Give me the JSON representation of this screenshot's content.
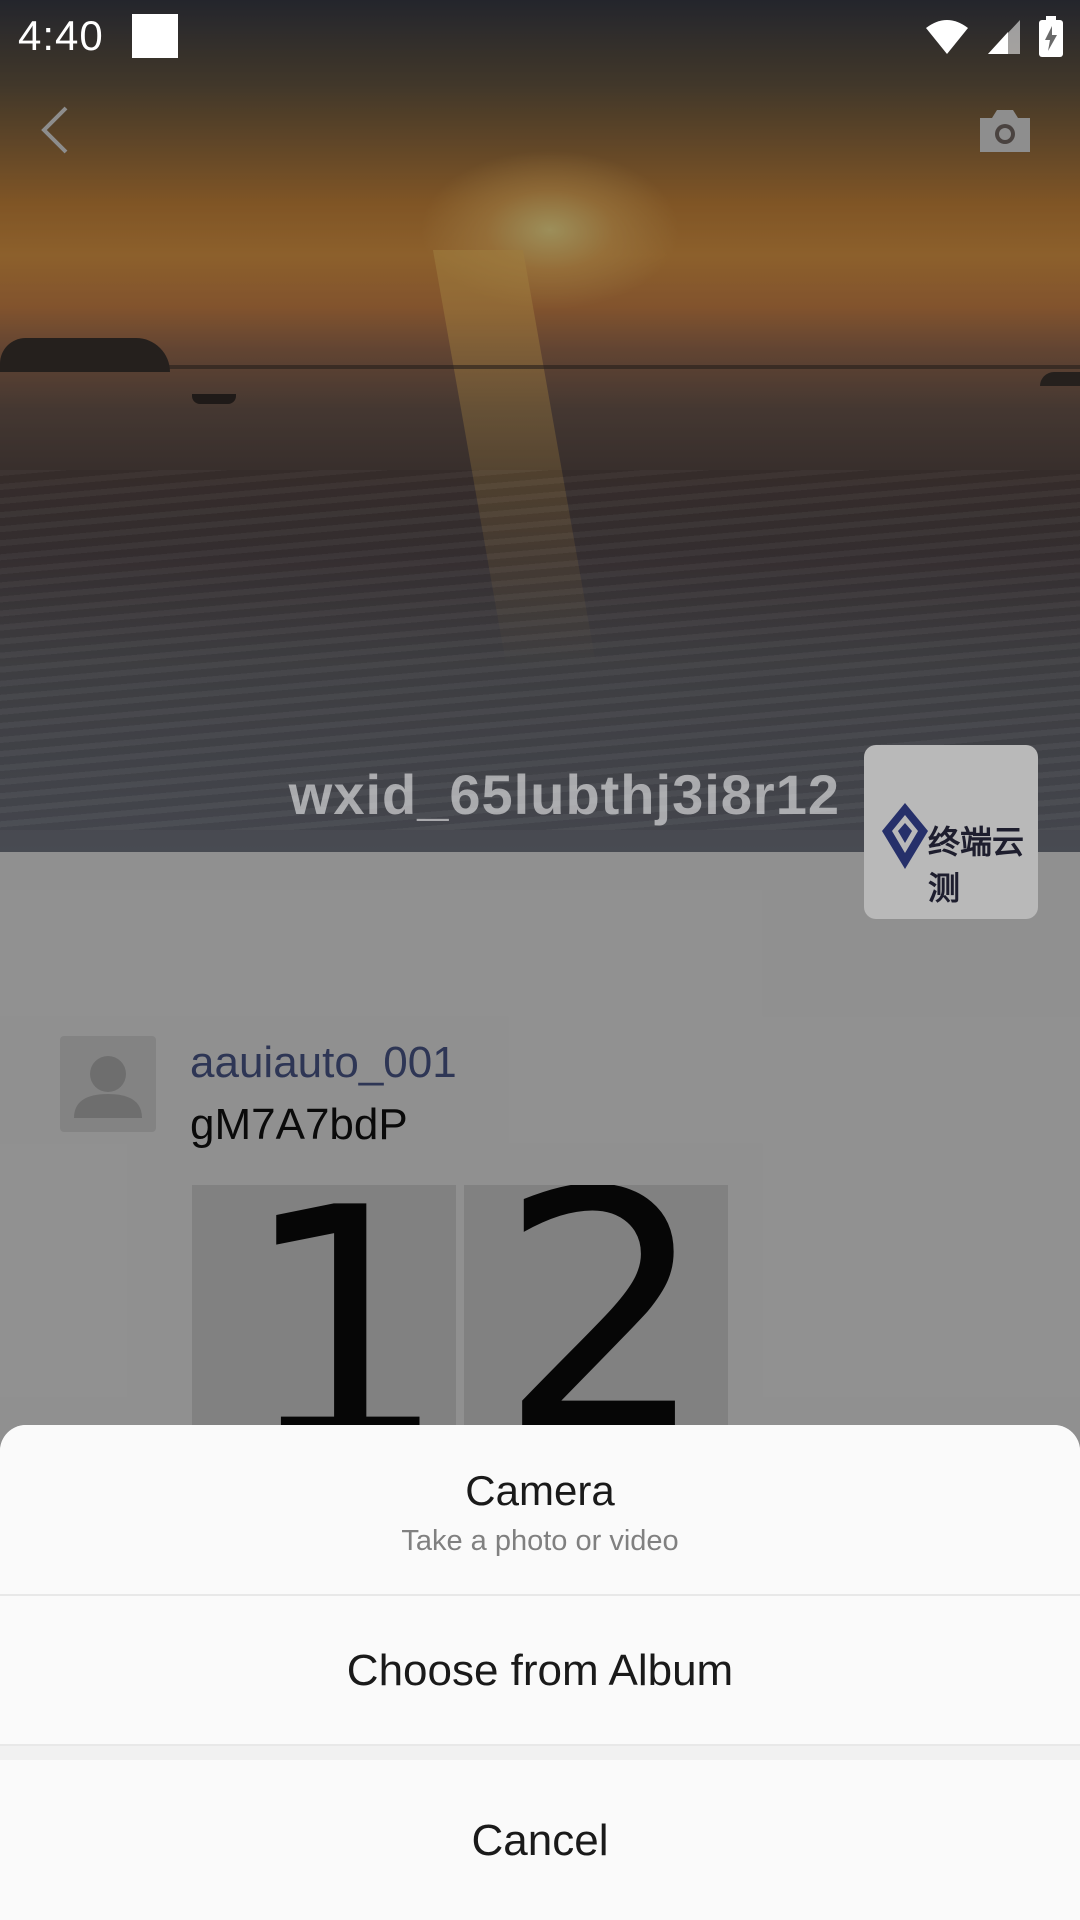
{
  "status_bar": {
    "time": "4:40"
  },
  "cover": {
    "username": "wxid_65lubthj3i8r12",
    "avatar_logo_text": "终端云测"
  },
  "post": {
    "author": "aauiauto_001",
    "text": "gM7A7bdP",
    "images": [
      "1",
      "2"
    ]
  },
  "action_sheet": {
    "camera_title": "Camera",
    "camera_subtitle": "Take a photo or video",
    "album_label": "Choose from Album",
    "cancel_label": "Cancel"
  },
  "icons": {
    "back": "chevron-left-icon",
    "camera": "camera-icon",
    "wifi": "wifi-icon",
    "signal": "signal-icon",
    "battery": "battery-charging-icon"
  }
}
